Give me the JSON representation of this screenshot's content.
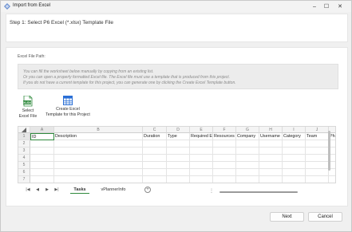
{
  "window": {
    "title": "Import from Excel",
    "controls": {
      "minimize": "–",
      "maximize": "☐",
      "close": "✕"
    }
  },
  "header": {
    "step_text": "Step 1: Select P6 Excel (*.xlsx) Template File"
  },
  "main": {
    "path_label": "Excel File Path:",
    "info_lines": [
      "You can fill the worksheet below manually by copying from an existing list.",
      "Or you can open a properly formatted Excel file. The Excel file must use a template that is produced from this project.",
      "If you do not have a current template for this project, you can generate one by clicking the Create Excel Template button."
    ],
    "actions": {
      "select": {
        "line1": "Select",
        "line2": "Excel File"
      },
      "create": {
        "line1": "Create Excel",
        "line2": "Template for this Project"
      }
    }
  },
  "sheet": {
    "columns": [
      "A",
      "B",
      "C",
      "D",
      "E",
      "F",
      "G",
      "H",
      "I",
      "J"
    ],
    "row_numbers": [
      "1",
      "2",
      "3",
      "4",
      "5",
      "6",
      "7"
    ],
    "header_row": [
      "ID",
      "Description",
      "Duration",
      "Type",
      "Required E",
      "Resources",
      "Company",
      "Username",
      "Category",
      "Team",
      "Phas"
    ]
  },
  "tabs": {
    "items": [
      "Tasks",
      "vPlannerInfo"
    ],
    "add": "+",
    "nav": [
      "|◀",
      "◀",
      "▶",
      "▶|"
    ],
    "splitter": "⋮"
  },
  "footer": {
    "next_label": "Next",
    "cancel_label": "Cancel"
  },
  "colors": {
    "excel_green": "#2f8a3d",
    "excel_blue": "#2a6fd6",
    "tab_accent": "#2f8a3d"
  }
}
